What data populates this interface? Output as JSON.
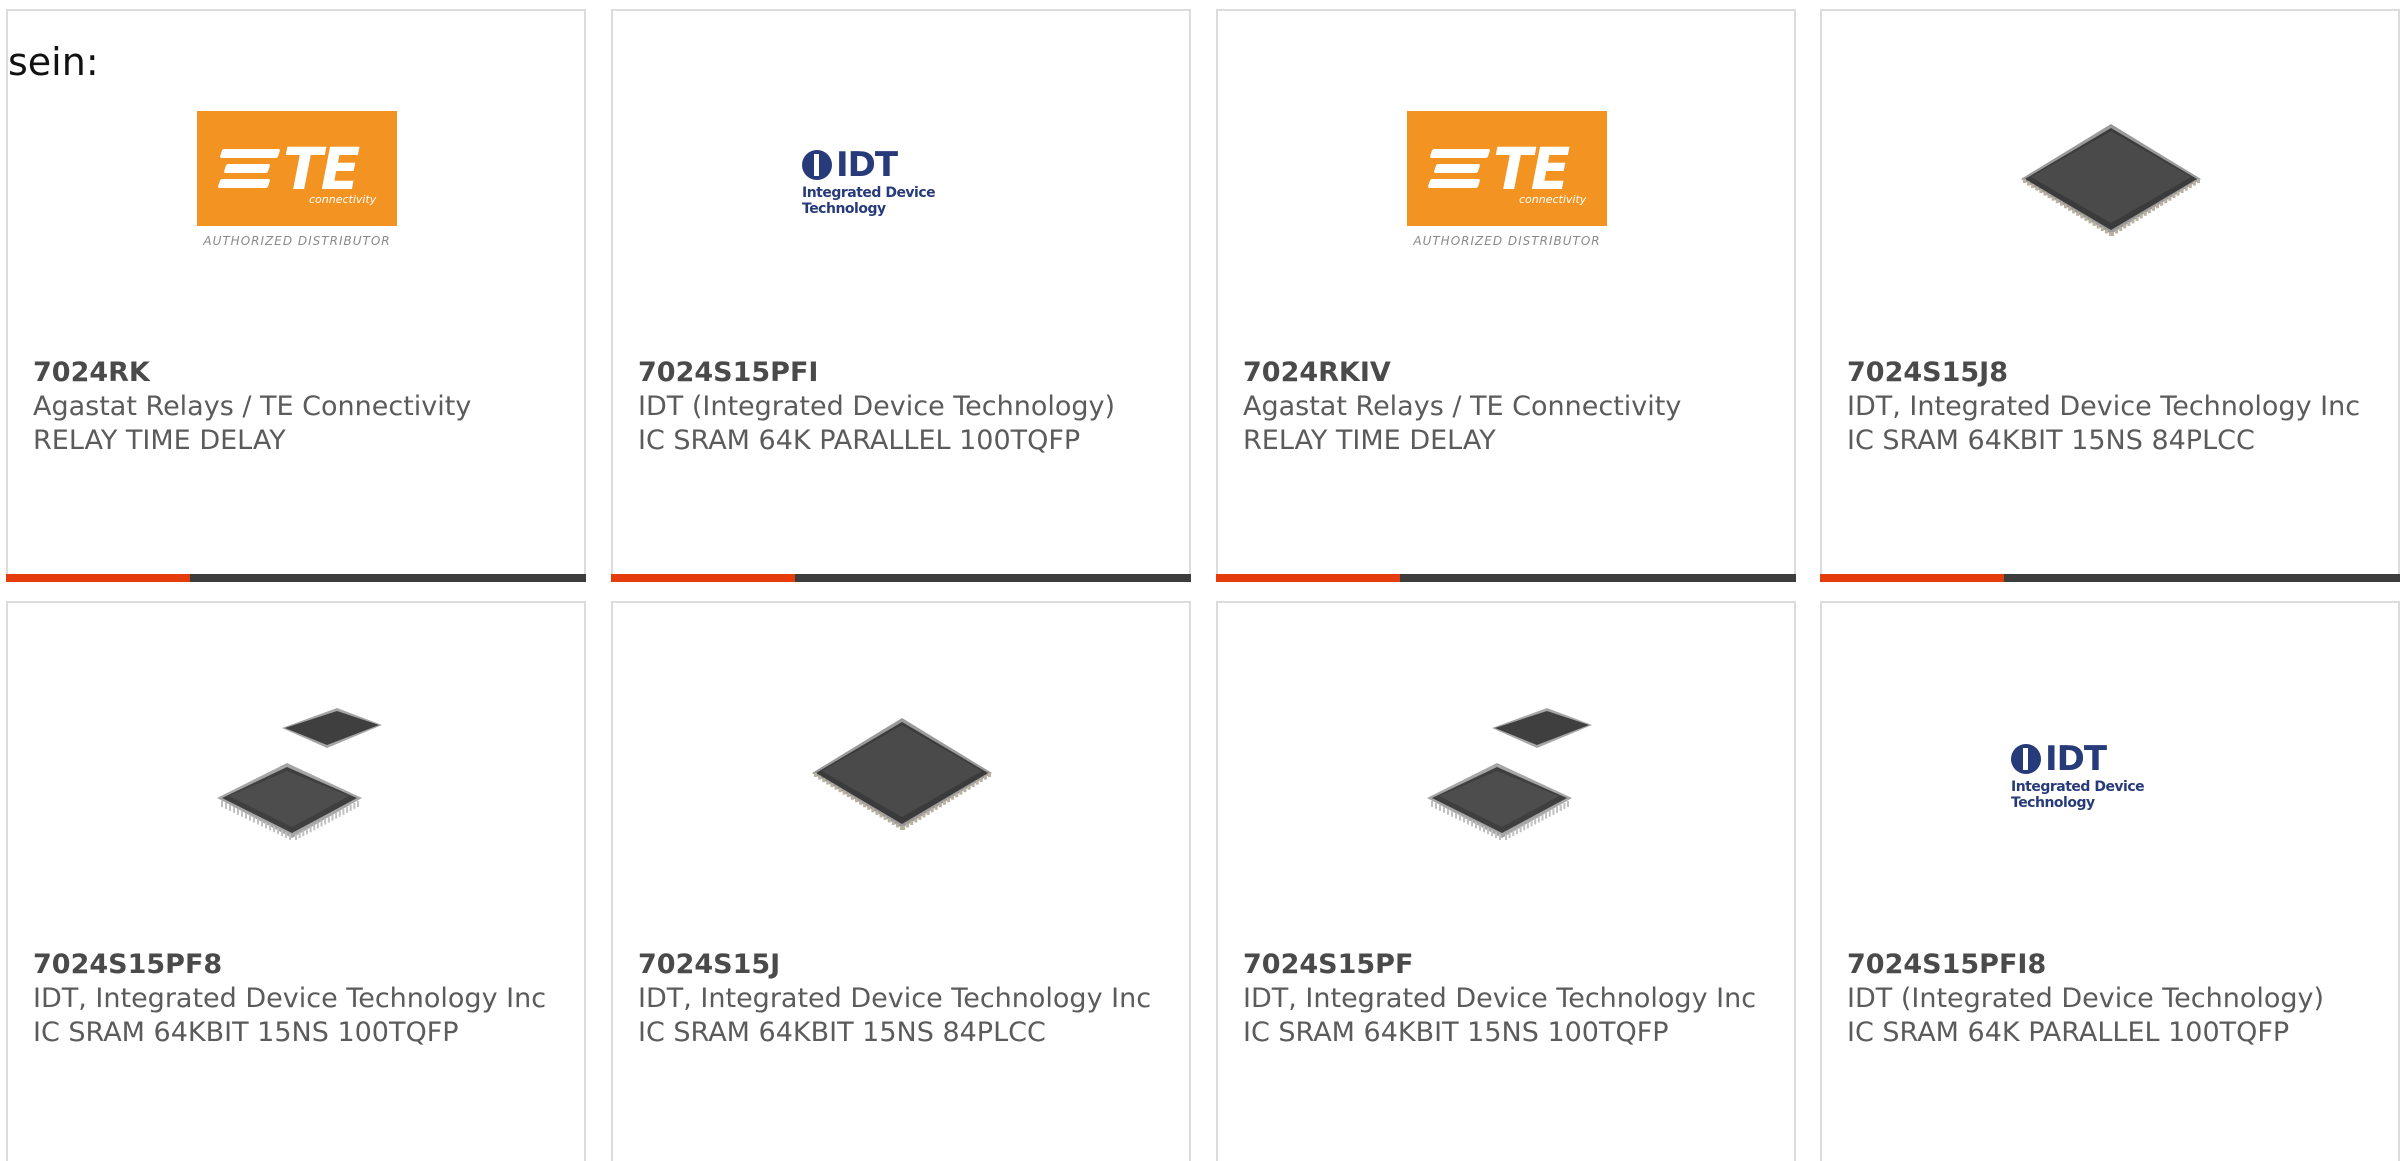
{
  "intro_text": "sein:",
  "colors": {
    "accent": "#e43c0a",
    "bar_dark": "#3d3d3d",
    "te_orange": "#f39322",
    "idt_blue": "#273b7a"
  },
  "logos": {
    "te": {
      "word": "TE",
      "sub": "connectivity",
      "tag": "AUTHORIZED DISTRIBUTOR"
    },
    "idt": {
      "word": "IDT",
      "sub": "Integrated Device Technology"
    }
  },
  "products": [
    {
      "part": "7024RK",
      "manufacturer": "Agastat Relays / TE Connectivity",
      "description": "RELAY TIME DELAY",
      "image": "te-logo"
    },
    {
      "part": "7024S15PFI",
      "manufacturer": "IDT (Integrated Device Technology)",
      "description": "IC SRAM 64K PARALLEL 100TQFP",
      "image": "idt-logo"
    },
    {
      "part": "7024RKIV",
      "manufacturer": "Agastat Relays / TE Connectivity",
      "description": "RELAY TIME DELAY",
      "image": "te-logo"
    },
    {
      "part": "7024S15J8",
      "manufacturer": "IDT, Integrated Device Technology Inc",
      "description": "IC SRAM 64KBIT 15NS 84PLCC",
      "image": "chip-plcc"
    },
    {
      "part": "7024S15PF8",
      "manufacturer": "IDT, Integrated Device Technology Inc",
      "description": "IC SRAM 64KBIT 15NS 100TQFP",
      "image": "chip-tqfp-pair"
    },
    {
      "part": "7024S15J",
      "manufacturer": "IDT, Integrated Device Technology Inc",
      "description": "IC SRAM 64KBIT 15NS 84PLCC",
      "image": "chip-plcc"
    },
    {
      "part": "7024S15PF",
      "manufacturer": "IDT, Integrated Device Technology Inc",
      "description": "IC SRAM 64KBIT 15NS 100TQFP",
      "image": "chip-tqfp-pair"
    },
    {
      "part": "7024S15PFI8",
      "manufacturer": "IDT (Integrated Device Technology)",
      "description": "IC SRAM 64K PARALLEL 100TQFP",
      "image": "idt-logo"
    }
  ]
}
